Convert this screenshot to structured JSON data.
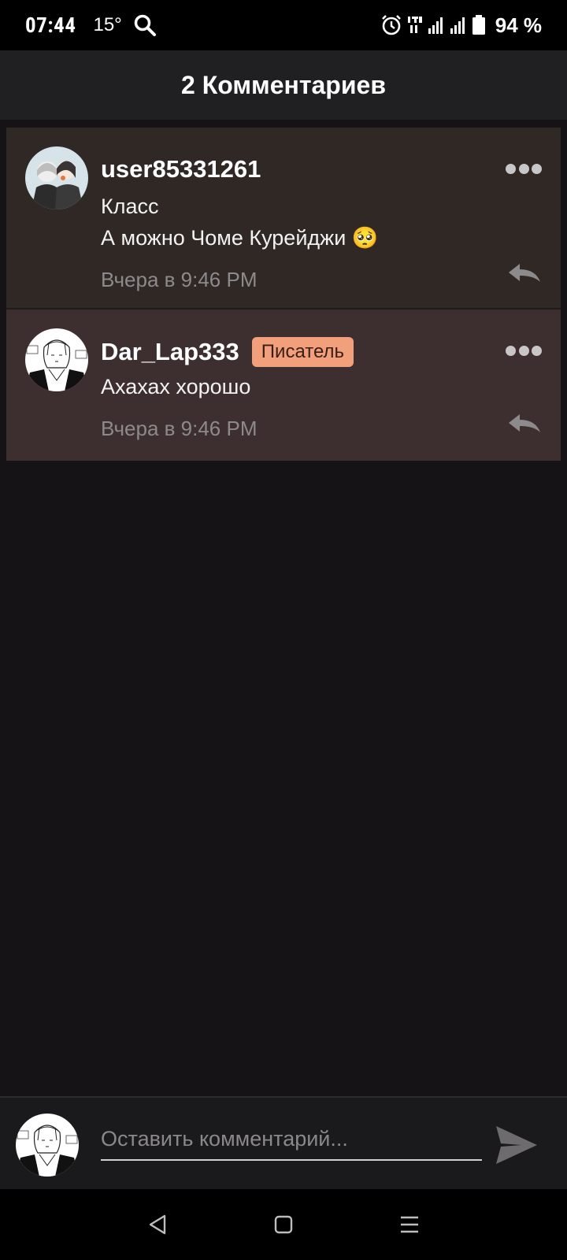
{
  "status_bar": {
    "time": "07:44",
    "temperature": "15°",
    "battery": "94 %",
    "icons": [
      "search-icon",
      "alarm-icon",
      "lte-icon",
      "signal-icon",
      "battery-icon"
    ]
  },
  "header": {
    "title": "2 Комментариев"
  },
  "comments": [
    {
      "author": "user85331261",
      "badge": "",
      "lines": [
        "Класс",
        "А можно Чоме Курейджи 🥺"
      ],
      "timestamp": "Вчера в 9:46 PM",
      "background": "#2f2825"
    },
    {
      "author": "Dar_Lap333",
      "badge": "Писатель",
      "lines": [
        "Ахахах хорошо"
      ],
      "timestamp": "Вчера в 9:46 PM",
      "background": "#3d2f2f"
    }
  ],
  "composer": {
    "placeholder": "Оставить комментарий..."
  },
  "colors": {
    "badge": "#f2a07b",
    "accent_text": "#ffffff",
    "muted_text": "#8d8a8c"
  }
}
